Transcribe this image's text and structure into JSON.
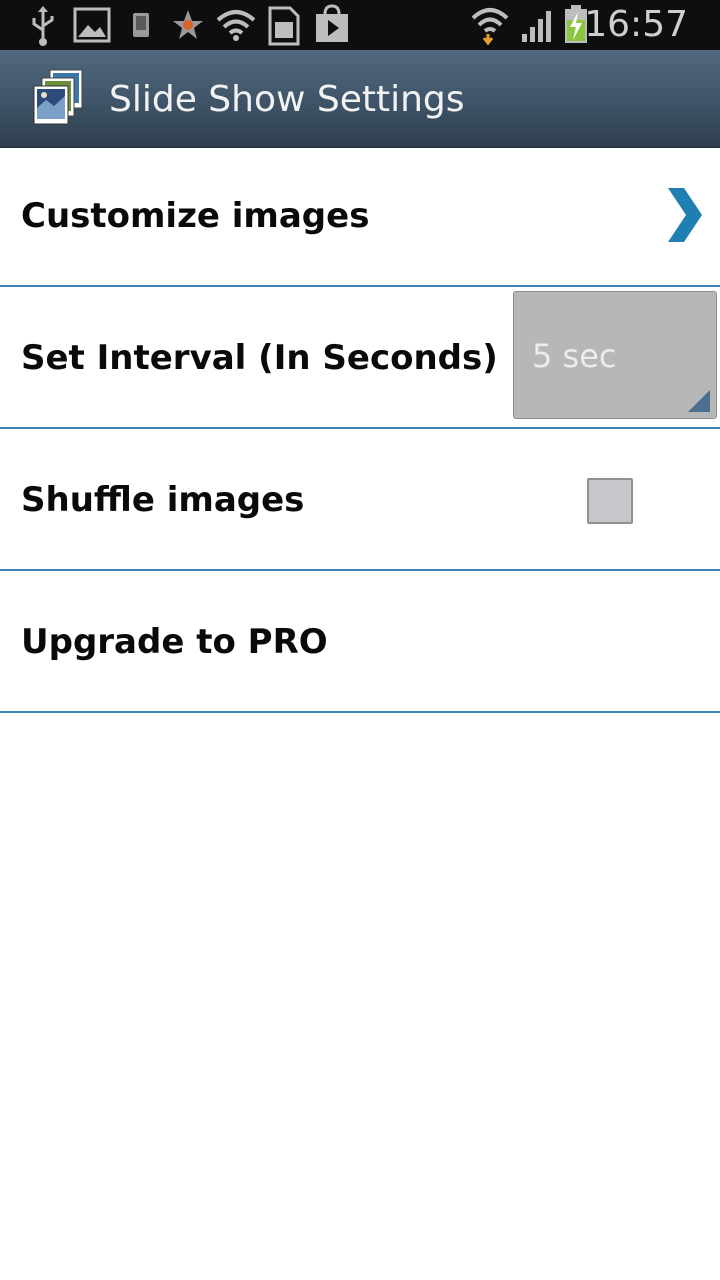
{
  "status_bar": {
    "time": "16:57",
    "icons": [
      "usb-icon",
      "gallery-icon",
      "phone-icon",
      "star-icon",
      "wifi-notification-icon",
      "sd-card-icon",
      "play-store-icon",
      "wifi-signal-icon",
      "cell-signal-icon",
      "battery-charging-icon"
    ]
  },
  "action_bar": {
    "title": "Slide Show Settings",
    "icon": "slideshow-app-icon"
  },
  "settings": {
    "customize_label": "Customize images",
    "interval_label": "Set Interval (In Seconds)",
    "interval_value": "5 sec",
    "shuffle_label": "Shuffle images",
    "shuffle_checked": false,
    "upgrade_label": "Upgrade to PRO"
  },
  "colors": {
    "divider": "#3a85b4",
    "chevron": "#1f7fb3",
    "action_bar": "#3f5468"
  }
}
